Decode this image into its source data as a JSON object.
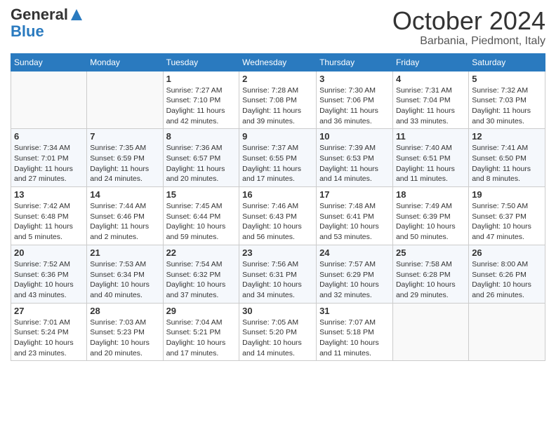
{
  "header": {
    "logo_line1": "General",
    "logo_line2": "Blue",
    "month": "October 2024",
    "location": "Barbania, Piedmont, Italy"
  },
  "weekdays": [
    "Sunday",
    "Monday",
    "Tuesday",
    "Wednesday",
    "Thursday",
    "Friday",
    "Saturday"
  ],
  "weeks": [
    [
      null,
      null,
      {
        "day": "1",
        "sunrise": "7:27 AM",
        "sunset": "7:10 PM",
        "daylight": "11 hours and 42 minutes."
      },
      {
        "day": "2",
        "sunrise": "7:28 AM",
        "sunset": "7:08 PM",
        "daylight": "11 hours and 39 minutes."
      },
      {
        "day": "3",
        "sunrise": "7:30 AM",
        "sunset": "7:06 PM",
        "daylight": "11 hours and 36 minutes."
      },
      {
        "day": "4",
        "sunrise": "7:31 AM",
        "sunset": "7:04 PM",
        "daylight": "11 hours and 33 minutes."
      },
      {
        "day": "5",
        "sunrise": "7:32 AM",
        "sunset": "7:03 PM",
        "daylight": "11 hours and 30 minutes."
      }
    ],
    [
      {
        "day": "6",
        "sunrise": "7:34 AM",
        "sunset": "7:01 PM",
        "daylight": "11 hours and 27 minutes."
      },
      {
        "day": "7",
        "sunrise": "7:35 AM",
        "sunset": "6:59 PM",
        "daylight": "11 hours and 24 minutes."
      },
      {
        "day": "8",
        "sunrise": "7:36 AM",
        "sunset": "6:57 PM",
        "daylight": "11 hours and 20 minutes."
      },
      {
        "day": "9",
        "sunrise": "7:37 AM",
        "sunset": "6:55 PM",
        "daylight": "11 hours and 17 minutes."
      },
      {
        "day": "10",
        "sunrise": "7:39 AM",
        "sunset": "6:53 PM",
        "daylight": "11 hours and 14 minutes."
      },
      {
        "day": "11",
        "sunrise": "7:40 AM",
        "sunset": "6:51 PM",
        "daylight": "11 hours and 11 minutes."
      },
      {
        "day": "12",
        "sunrise": "7:41 AM",
        "sunset": "6:50 PM",
        "daylight": "11 hours and 8 minutes."
      }
    ],
    [
      {
        "day": "13",
        "sunrise": "7:42 AM",
        "sunset": "6:48 PM",
        "daylight": "11 hours and 5 minutes."
      },
      {
        "day": "14",
        "sunrise": "7:44 AM",
        "sunset": "6:46 PM",
        "daylight": "11 hours and 2 minutes."
      },
      {
        "day": "15",
        "sunrise": "7:45 AM",
        "sunset": "6:44 PM",
        "daylight": "10 hours and 59 minutes."
      },
      {
        "day": "16",
        "sunrise": "7:46 AM",
        "sunset": "6:43 PM",
        "daylight": "10 hours and 56 minutes."
      },
      {
        "day": "17",
        "sunrise": "7:48 AM",
        "sunset": "6:41 PM",
        "daylight": "10 hours and 53 minutes."
      },
      {
        "day": "18",
        "sunrise": "7:49 AM",
        "sunset": "6:39 PM",
        "daylight": "10 hours and 50 minutes."
      },
      {
        "day": "19",
        "sunrise": "7:50 AM",
        "sunset": "6:37 PM",
        "daylight": "10 hours and 47 minutes."
      }
    ],
    [
      {
        "day": "20",
        "sunrise": "7:52 AM",
        "sunset": "6:36 PM",
        "daylight": "10 hours and 43 minutes."
      },
      {
        "day": "21",
        "sunrise": "7:53 AM",
        "sunset": "6:34 PM",
        "daylight": "10 hours and 40 minutes."
      },
      {
        "day": "22",
        "sunrise": "7:54 AM",
        "sunset": "6:32 PM",
        "daylight": "10 hours and 37 minutes."
      },
      {
        "day": "23",
        "sunrise": "7:56 AM",
        "sunset": "6:31 PM",
        "daylight": "10 hours and 34 minutes."
      },
      {
        "day": "24",
        "sunrise": "7:57 AM",
        "sunset": "6:29 PM",
        "daylight": "10 hours and 32 minutes."
      },
      {
        "day": "25",
        "sunrise": "7:58 AM",
        "sunset": "6:28 PM",
        "daylight": "10 hours and 29 minutes."
      },
      {
        "day": "26",
        "sunrise": "8:00 AM",
        "sunset": "6:26 PM",
        "daylight": "10 hours and 26 minutes."
      }
    ],
    [
      {
        "day": "27",
        "sunrise": "7:01 AM",
        "sunset": "5:24 PM",
        "daylight": "10 hours and 23 minutes."
      },
      {
        "day": "28",
        "sunrise": "7:03 AM",
        "sunset": "5:23 PM",
        "daylight": "10 hours and 20 minutes."
      },
      {
        "day": "29",
        "sunrise": "7:04 AM",
        "sunset": "5:21 PM",
        "daylight": "10 hours and 17 minutes."
      },
      {
        "day": "30",
        "sunrise": "7:05 AM",
        "sunset": "5:20 PM",
        "daylight": "10 hours and 14 minutes."
      },
      {
        "day": "31",
        "sunrise": "7:07 AM",
        "sunset": "5:18 PM",
        "daylight": "10 hours and 11 minutes."
      },
      null,
      null
    ]
  ],
  "labels": {
    "sunrise": "Sunrise:",
    "sunset": "Sunset:",
    "daylight": "Daylight:"
  }
}
